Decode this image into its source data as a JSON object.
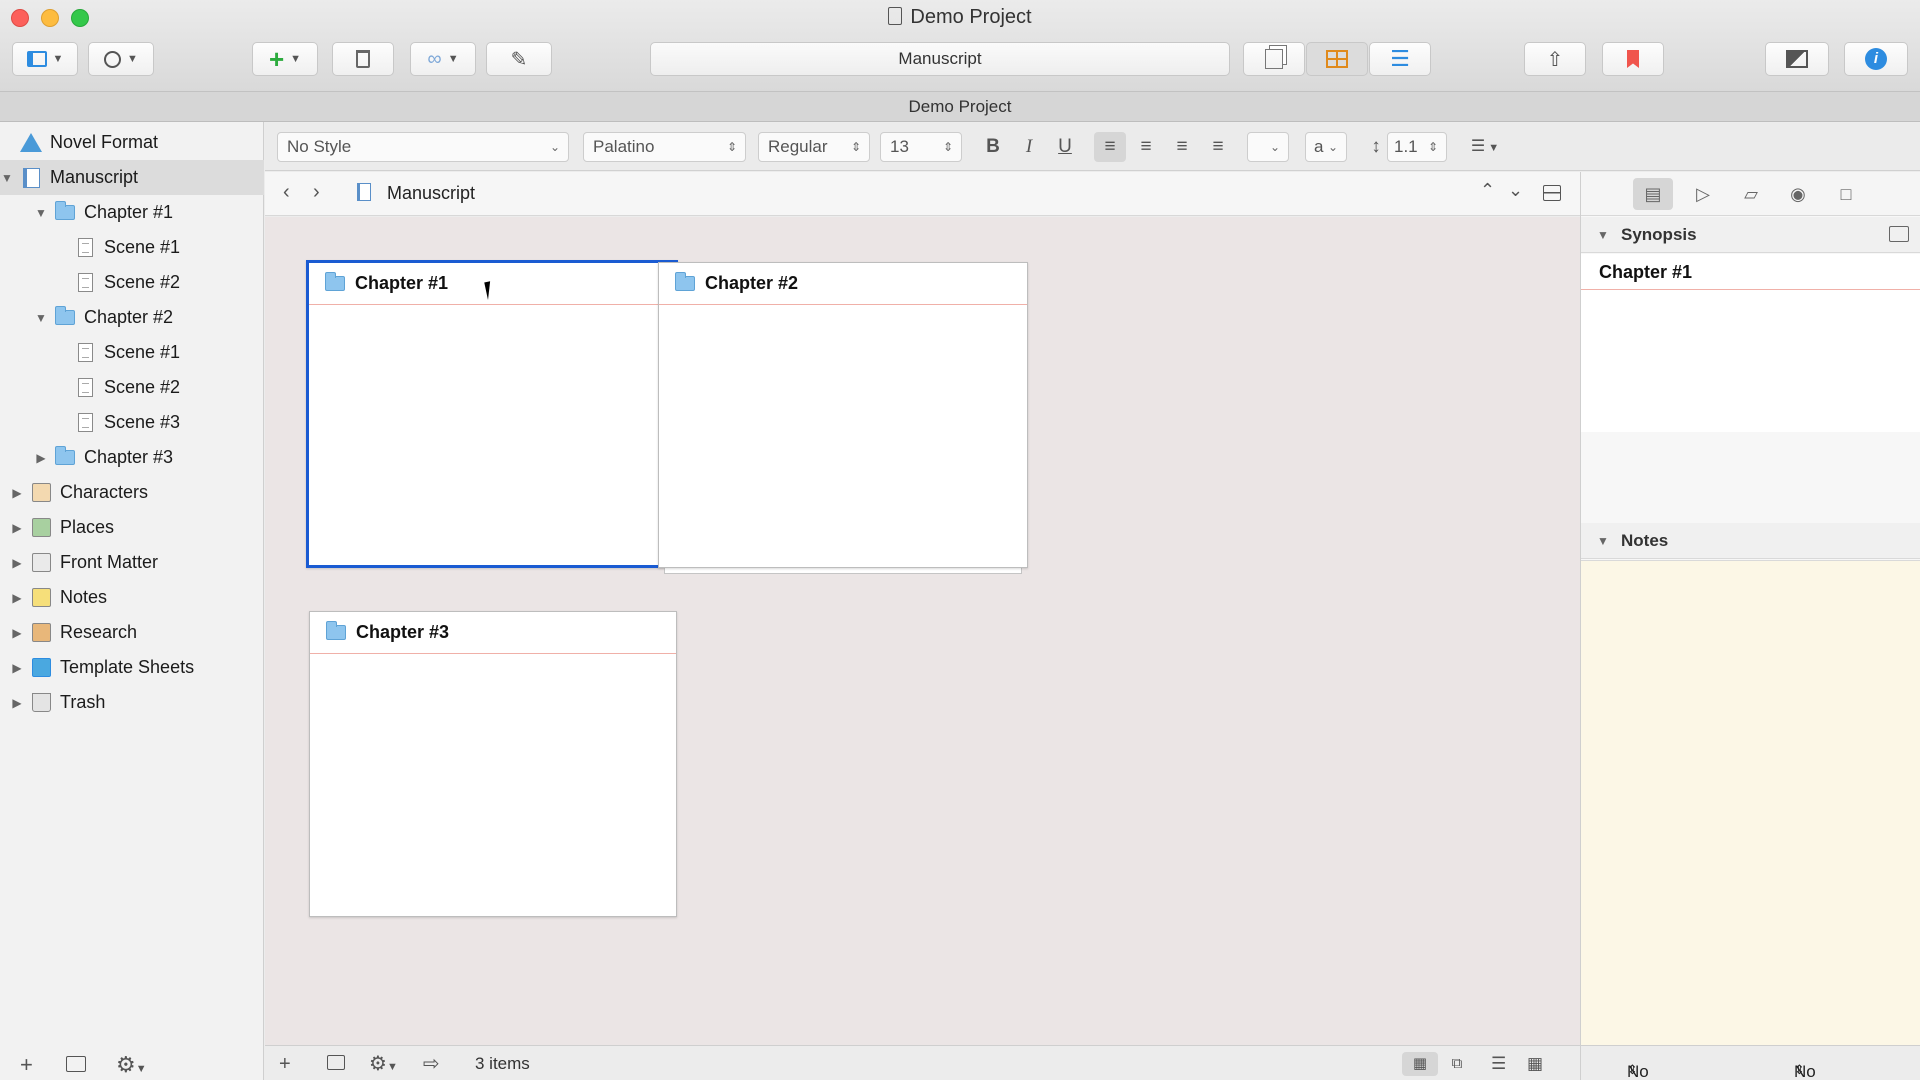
{
  "window": {
    "title": "Demo Project",
    "subtitle": "Demo Project"
  },
  "toolbar": {
    "center_field": "Manuscript"
  },
  "binder": {
    "items": [
      {
        "label": "Novel Format",
        "icon": "warning-icon"
      },
      {
        "label": "Manuscript",
        "icon": "manuscript-icon"
      },
      {
        "label": "Chapter #1",
        "icon": "folder-icon"
      },
      {
        "label": "Scene #1",
        "icon": "document-icon"
      },
      {
        "label": "Scene #2",
        "icon": "document-icon"
      },
      {
        "label": "Chapter #2",
        "icon": "folder-icon"
      },
      {
        "label": "Scene #1",
        "icon": "document-icon"
      },
      {
        "label": "Scene #2",
        "icon": "document-icon"
      },
      {
        "label": "Scene #3",
        "icon": "document-icon"
      },
      {
        "label": "Chapter #3",
        "icon": "folder-icon"
      },
      {
        "label": "Characters",
        "icon": "characters-icon"
      },
      {
        "label": "Places",
        "icon": "places-icon"
      },
      {
        "label": "Front Matter",
        "icon": "front-matter-icon"
      },
      {
        "label": "Notes",
        "icon": "notes-icon"
      },
      {
        "label": "Research",
        "icon": "research-icon"
      },
      {
        "label": "Template Sheets",
        "icon": "template-sheets-icon"
      },
      {
        "label": "Trash",
        "icon": "trash-icon"
      }
    ]
  },
  "format_bar": {
    "style": "No Style",
    "font": "Palatino",
    "weight": "Regular",
    "size": "13",
    "bold": "B",
    "italic": "I",
    "underline": "U",
    "highlight": "a",
    "line_spacing": "1.1"
  },
  "editor": {
    "nav_title": "Manuscript",
    "cards": [
      {
        "title": "Chapter #1",
        "selected": true
      },
      {
        "title": "Chapter #2",
        "selected": false
      },
      {
        "title": "Chapter #3",
        "selected": false
      }
    ],
    "item_count": "3 items"
  },
  "inspector": {
    "synopsis_header": "Synopsis",
    "synopsis_title": "Chapter #1",
    "notes_header": "Notes",
    "label_select": "No Label",
    "status_select": "No Status"
  },
  "colors": {
    "selection_border": "#1a5bd2",
    "folder": "#8ec5ee",
    "notes_background": "#fcf7e6",
    "corkboard": "#ebe5e5",
    "bookmark_red": "#f0554d",
    "info_blue": "#2d8ce0"
  }
}
